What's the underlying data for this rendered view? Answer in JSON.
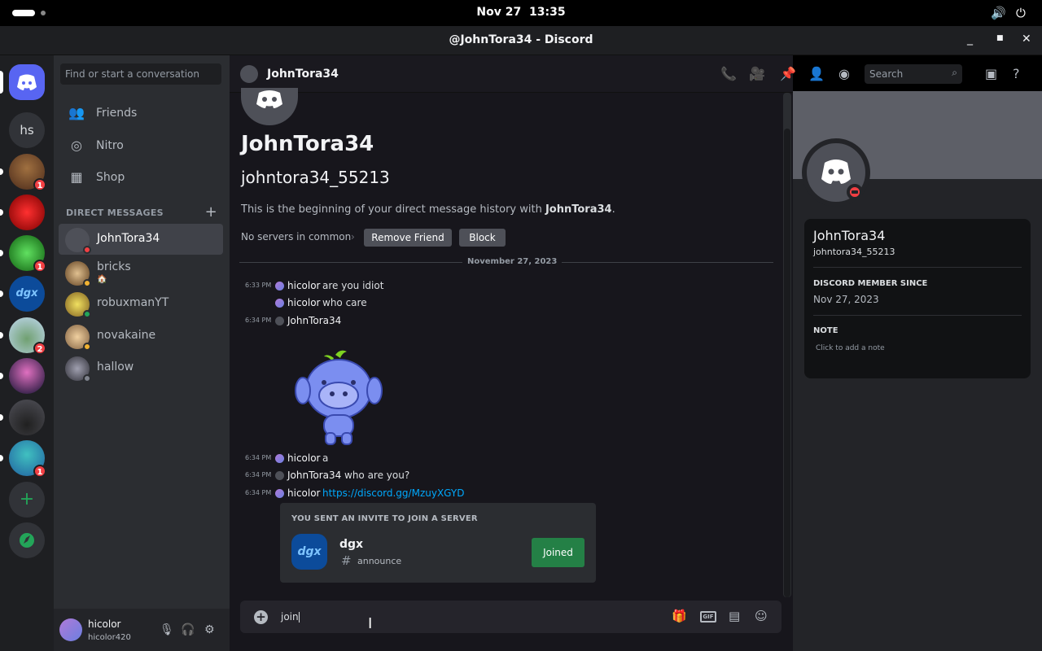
{
  "system": {
    "date": "Nov 27",
    "time": "13:35",
    "volume_icon": "volume-icon",
    "power_icon": "power-icon"
  },
  "window": {
    "title": "@JohnTora34 - Discord"
  },
  "servers": {
    "home_icon": "discord-icon",
    "hs_label": "hs",
    "badges": [
      "1",
      "1",
      "2",
      "1"
    ],
    "dgx_label": "dgx"
  },
  "dms": {
    "search_placeholder": "Find or start a conversation",
    "nav": [
      {
        "label": "Friends",
        "icon": "friends-icon"
      },
      {
        "label": "Nitro",
        "icon": "nitro-icon"
      },
      {
        "label": "Shop",
        "icon": "shop-icon"
      }
    ],
    "header": "DIRECT MESSAGES",
    "items": [
      {
        "name": "JohnTora34",
        "sub": ""
      },
      {
        "name": "bricks",
        "sub": "🏠"
      },
      {
        "name": "robuxmanYT",
        "sub": ""
      },
      {
        "name": "novakaine",
        "sub": ""
      },
      {
        "name": "hallow",
        "sub": ""
      }
    ]
  },
  "user": {
    "name": "hicolor",
    "tag": "hicolor420"
  },
  "chat": {
    "header_name": "JohnTora34",
    "search_placeholder": "Search",
    "profile_name": "JohnTora34",
    "profile_username": "johntora34_55213",
    "intro_prefix": "This is the beginning of your direct message history with ",
    "intro_name": "JohnTora34",
    "intro_suffix": ".",
    "no_servers": "No servers in common",
    "remove_friend": "Remove Friend",
    "block": "Block",
    "date_divider": "November 27, 2023",
    "messages": [
      {
        "time": "6:33 PM",
        "author": "hicolor",
        "text": "are you idiot"
      },
      {
        "time": "",
        "author": "hicolor",
        "text": "who care"
      },
      {
        "time": "6:34 PM",
        "author": "JohnTora34",
        "text": ""
      },
      {
        "time": "6:34 PM",
        "author": "hicolor",
        "text": "a"
      },
      {
        "time": "6:34 PM",
        "author": "JohnTora34",
        "text": "who are you?"
      },
      {
        "time": "6:34 PM",
        "author": "hicolor",
        "text": "https://discord.gg/MzuyXGYD"
      }
    ],
    "invite": {
      "heading": "YOU SENT AN INVITE TO JOIN A SERVER",
      "server": "dgx",
      "server_icon_text": "dgx",
      "channel": "announce",
      "button": "Joined"
    },
    "composer_text": "join"
  },
  "profile": {
    "name": "JohnTora34",
    "username": "johntora34_55213",
    "member_since_label": "DISCORD MEMBER SINCE",
    "member_since": "Nov 27, 2023",
    "note_label": "NOTE",
    "note_placeholder": "Click to add a note"
  },
  "colors": {
    "accent": "#5865f2",
    "danger": "#f23f43",
    "success": "#248046",
    "link": "#00a8fc"
  }
}
